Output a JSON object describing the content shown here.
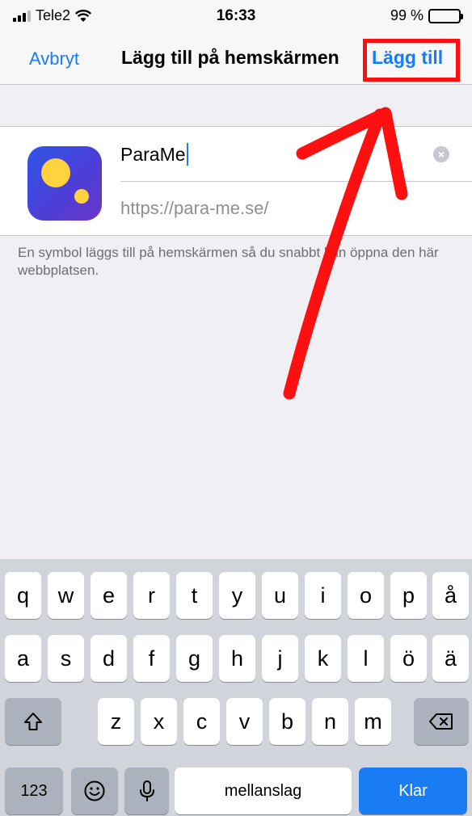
{
  "status_bar": {
    "carrier": "Tele2",
    "time": "16:33",
    "battery": "99 %"
  },
  "nav": {
    "cancel_label": "Avbryt",
    "title": "Lägg till på hemskärmen",
    "add_label": "Lägg till"
  },
  "form": {
    "name_value": "ParaMe",
    "url_value": "https://para-me.se/"
  },
  "hint": "En symbol läggs till på hemskärmen så du snabbt kan öppna den här webbplatsen.",
  "keyboard": {
    "row1": [
      "q",
      "w",
      "e",
      "r",
      "t",
      "y",
      "u",
      "i",
      "o",
      "p",
      "å"
    ],
    "row2": [
      "a",
      "s",
      "d",
      "f",
      "g",
      "h",
      "j",
      "k",
      "l",
      "ö",
      "ä"
    ],
    "row3": [
      "z",
      "x",
      "c",
      "v",
      "b",
      "n",
      "m"
    ],
    "numbers_label": "123",
    "space_label": "mellanslag",
    "done_label": "Klar"
  },
  "icons": [
    "signal-icon",
    "wifi-icon",
    "battery-icon",
    "clear-icon",
    "shift-icon",
    "backspace-icon",
    "emoji-icon",
    "microphone-icon"
  ],
  "colors": {
    "accent": "#1a7cf5",
    "annotation": "#ff1010",
    "icon_gradient_start": "#2f55e6",
    "icon_gradient_end": "#6a35c8",
    "icon_dot": "#ffd33d"
  }
}
